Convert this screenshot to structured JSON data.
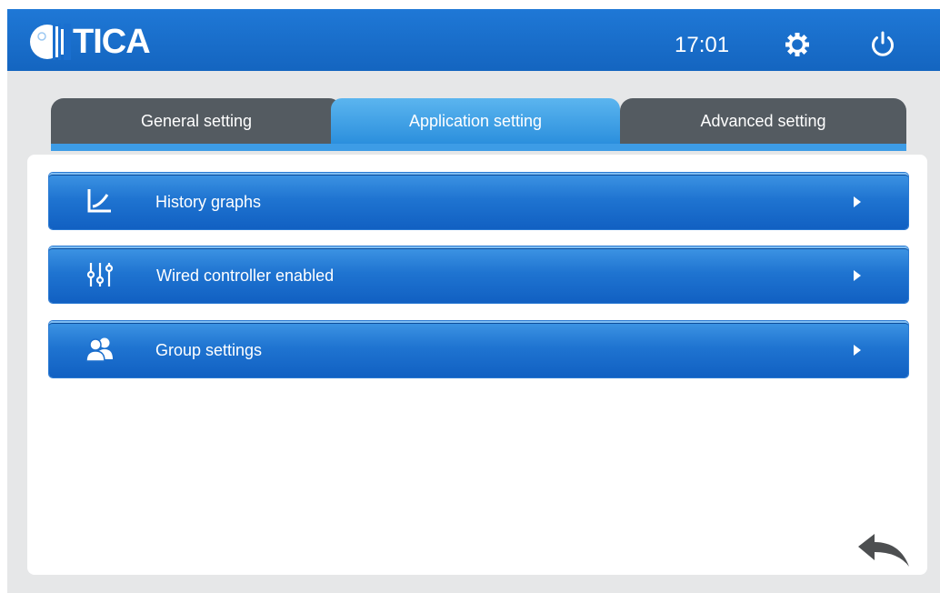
{
  "header": {
    "brand": "TICA",
    "time": "17:01",
    "colors": {
      "bar": "#1a6fcf",
      "text": "#ffffff"
    },
    "icons": {
      "settings": "gear-icon",
      "power": "power-icon"
    }
  },
  "tabs": [
    {
      "label": "General setting",
      "active": false
    },
    {
      "label": "Application setting",
      "active": true
    },
    {
      "label": "Advanced setting",
      "active": false
    }
  ],
  "menu": [
    {
      "label": "History graphs",
      "icon": "chart-icon"
    },
    {
      "label": "Wired controller enabled",
      "icon": "sliders-icon"
    },
    {
      "label": "Group settings",
      "icon": "users-icon"
    }
  ],
  "footer": {
    "back_icon": "back-arrow-icon"
  }
}
